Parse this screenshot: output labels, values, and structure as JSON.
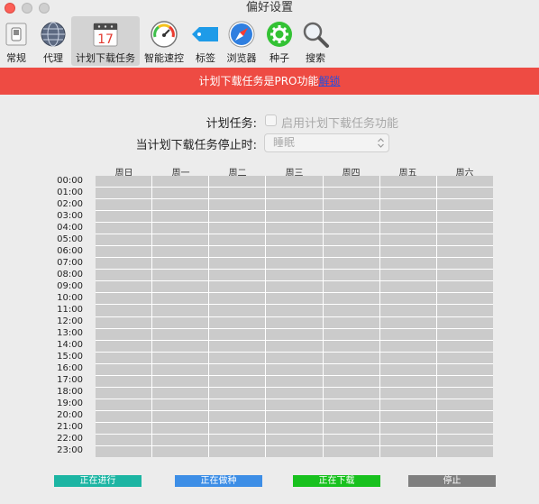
{
  "window": {
    "title": "偏好设置"
  },
  "toolbar": {
    "items": [
      {
        "label": "常规",
        "icon": "switch-icon"
      },
      {
        "label": "代理",
        "icon": "network-globe-icon"
      },
      {
        "label": "计划下载任务",
        "icon": "calendar-icon",
        "calendar_day": "17",
        "active": true
      },
      {
        "label": "智能速控",
        "icon": "speedometer-icon"
      },
      {
        "label": "标签",
        "icon": "tag-icon"
      },
      {
        "label": "浏览器",
        "icon": "compass-icon"
      },
      {
        "label": "种子",
        "icon": "gear-icon"
      },
      {
        "label": "搜索",
        "icon": "magnifier-icon"
      }
    ]
  },
  "banner": {
    "text": "计划下载任务是PRO功能",
    "link": "解锁",
    "bg_color": "#ee4b43",
    "link_color": "#2b4fd9"
  },
  "schedule": {
    "enable_label": "计划任务:",
    "enable_checkbox_label": "启用计划下载任务功能",
    "enabled": false,
    "stop_label": "当计划下载任务停止时:",
    "stop_action": "睡眠"
  },
  "grid": {
    "days": [
      "周日",
      "周一",
      "周二",
      "周三",
      "周四",
      "周五",
      "周六"
    ],
    "hours": [
      "00:00",
      "01:00",
      "02:00",
      "03:00",
      "04:00",
      "05:00",
      "06:00",
      "07:00",
      "08:00",
      "09:00",
      "10:00",
      "11:00",
      "12:00",
      "13:00",
      "14:00",
      "15:00",
      "16:00",
      "17:00",
      "18:00",
      "19:00",
      "20:00",
      "21:00",
      "22:00",
      "23:00"
    ],
    "cell_color": "#cbcbcb"
  },
  "legend": [
    {
      "label": "正在进行",
      "color": "#1cb5a3"
    },
    {
      "label": "正在做种",
      "color": "#3d8ee6"
    },
    {
      "label": "正在下载",
      "color": "#18c11e"
    },
    {
      "label": "停止",
      "color": "#7f7f7f"
    }
  ]
}
